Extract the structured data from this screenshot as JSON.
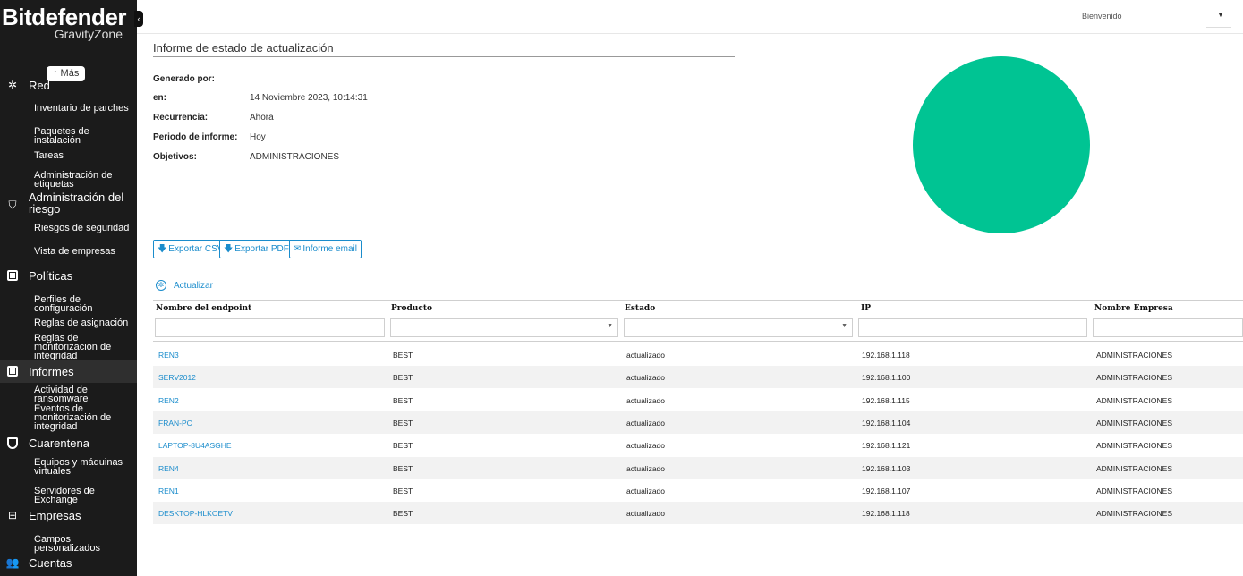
{
  "sidebar": {
    "brand": "Bitdefender",
    "brand_sub": "GravityZone",
    "mas_label": "↑ Más",
    "groups": {
      "red": "Red",
      "riesgo": "Administración del riesgo",
      "politicas": "Políticas",
      "informes": "Informes",
      "cuarentena": "Cuarentena",
      "empresas": "Empresas",
      "cuentas": "Cuentas"
    },
    "items": {
      "inventario": "Inventario de parches",
      "paquetes": "Paquetes de instalación",
      "tareas": "Tareas",
      "etiquetas": "Administración de etiquetas",
      "riesgos": "Riesgos de seguridad",
      "vista": "Vista de empresas",
      "perfiles": "Perfiles de configuración",
      "reglas_asig": "Reglas de asignación",
      "reglas_mon": "Reglas de monitorización de integridad",
      "actividad": "Actividad de ransomware",
      "eventos": "Eventos de monitorización de integridad",
      "equipos": "Equipos y máquinas virtuales",
      "servidores": "Servidores de Exchange",
      "campos": "Campos personalizados"
    },
    "active_group": "Informes"
  },
  "topbar": {
    "welcome": "Bienvenido"
  },
  "report": {
    "title": "Informe de estado de actualización",
    "info": [
      {
        "label": "Generado por:",
        "value": ""
      },
      {
        "label": "en:",
        "value": "14 Noviembre 2023, 10:14:31"
      },
      {
        "label": "Recurrencia:",
        "value": "Ahora"
      },
      {
        "label": "Periodo de informe:",
        "value": "Hoy"
      },
      {
        "label": "Objetivos:",
        "value": "ADMINISTRACIONES"
      }
    ],
    "pie_color": "#00c493",
    "buttons": {
      "csv": "Exportar CSV",
      "pdf": "Exportar PDF",
      "email": "Informe email"
    },
    "refresh": "Actualizar"
  },
  "table": {
    "columns": [
      "Nombre del endpoint",
      "Producto",
      "Estado",
      "IP",
      "Nombre Empresa"
    ],
    "rows": [
      {
        "endpoint": "REN3",
        "producto": "BEST",
        "estado": "actualizado",
        "ip": "192.168.1.118",
        "empresa": "ADMINISTRACIONES"
      },
      {
        "endpoint": "SERV2012",
        "producto": "BEST",
        "estado": "actualizado",
        "ip": "192.168.1.100",
        "empresa": "ADMINISTRACIONES"
      },
      {
        "endpoint": "REN2",
        "producto": "BEST",
        "estado": "actualizado",
        "ip": "192.168.1.115",
        "empresa": "ADMINISTRACIONES"
      },
      {
        "endpoint": "FRAN-PC",
        "producto": "BEST",
        "estado": "actualizado",
        "ip": "192.168.1.104",
        "empresa": "ADMINISTRACIONES"
      },
      {
        "endpoint": "LAPTOP-8U4ASGHE",
        "producto": "BEST",
        "estado": "actualizado",
        "ip": "192.168.1.121",
        "empresa": "ADMINISTRACIONES"
      },
      {
        "endpoint": "REN4",
        "producto": "BEST",
        "estado": "actualizado",
        "ip": "192.168.1.103",
        "empresa": "ADMINISTRACIONES"
      },
      {
        "endpoint": "REN1",
        "producto": "BEST",
        "estado": "actualizado",
        "ip": "192.168.1.107",
        "empresa": "ADMINISTRACIONES"
      },
      {
        "endpoint": "DESKTOP-HLKOETV",
        "producto": "BEST",
        "estado": "actualizado",
        "ip": "192.168.1.118",
        "empresa": "ADMINISTRACIONES"
      }
    ]
  }
}
